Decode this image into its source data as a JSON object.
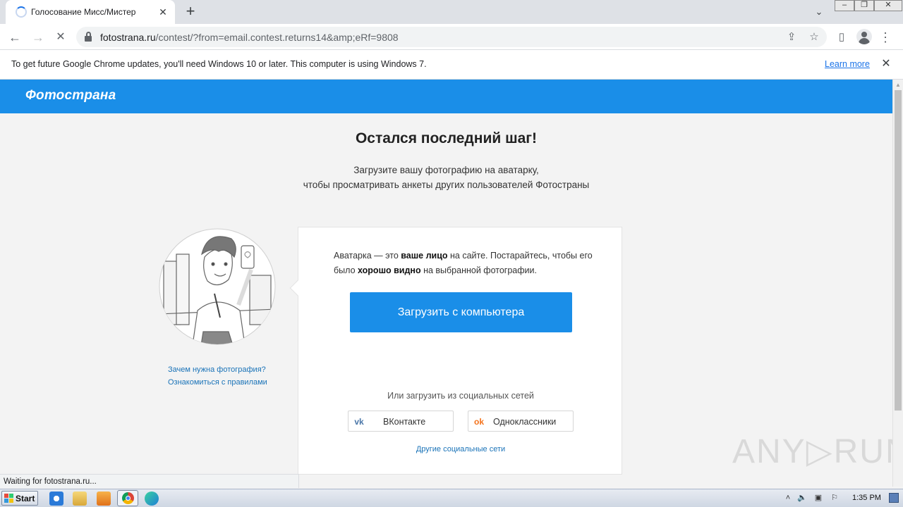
{
  "browser": {
    "tab_title": "Голосование Мисс/Мистер",
    "url_domain": "fotostrana.ru",
    "url_path": "/contest/?from=email.contest.returns14&amp;eRf=9808",
    "status_text": "Waiting for fotostrana.ru..."
  },
  "infobar": {
    "message": "To get future Google Chrome updates, you'll need Windows 10 or later. This computer is using Windows 7.",
    "learn_more": "Learn more"
  },
  "site": {
    "logo": "Фотострана",
    "title": "Остался последний шаг!",
    "subtitle_line1": "Загрузите вашу фотографию на аватарку,",
    "subtitle_line2": "чтобы просматривать анкеты других пользователей Фотостраны",
    "why_photo_link": "Зачем нужна фотография?",
    "rules_link": "Ознакомиться с правилами",
    "card": {
      "text_part1": "Аватарка — это ",
      "text_bold1": "ваше лицо",
      "text_part2": " на сайте. Постарайтесь, чтобы его было ",
      "text_bold2": "хорошо видно",
      "text_part3": " на выбранной фотографии.",
      "upload_button": "Загрузить с компьютера",
      "social_caption": "Или загрузить из социальных сетей",
      "vk_label": "ВКонтакте",
      "vk_icon_glyph": "vk",
      "ok_label": "Одноклассники",
      "ok_icon_glyph": "ok",
      "other_social": "Другие социальные сети"
    }
  },
  "watermark": "ANY▷RUN",
  "taskbar": {
    "start_label": "Start",
    "clock": "1:35 PM"
  },
  "colors": {
    "brand_blue": "#1a8ee8",
    "link_blue": "#1a73b8",
    "vk_blue": "#4a76a8",
    "ok_orange": "#f4731c"
  }
}
